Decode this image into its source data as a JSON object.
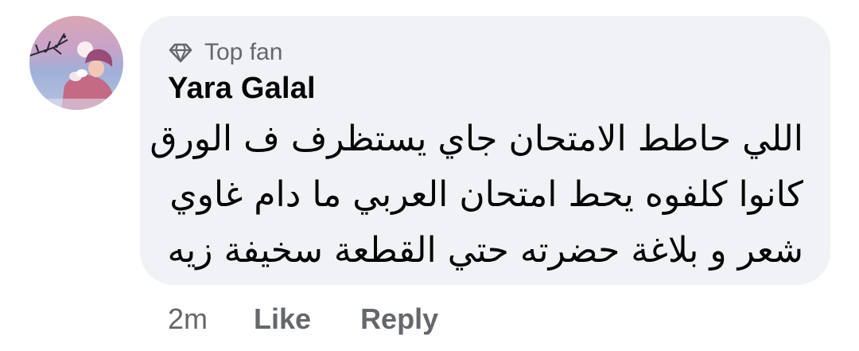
{
  "comment": {
    "badge_icon": "diamond-icon",
    "badge_label": "Top fan",
    "author": "Yara Galal",
    "lines": [
      "اللي حاطط الامتحان جاي يستظرف ف الورق",
      "كانوا كلفوه يحط امتحان العربي ما دام غاوي",
      "شعر و بلاغة حضرته حتي القطعة سخيفة زيه"
    ]
  },
  "actions": {
    "time": "2m",
    "like_label": "Like",
    "reply_label": "Reply"
  },
  "colors": {
    "bubble": "#f0f2f5",
    "secondary_text": "#65676b",
    "primary_text": "#050505"
  }
}
